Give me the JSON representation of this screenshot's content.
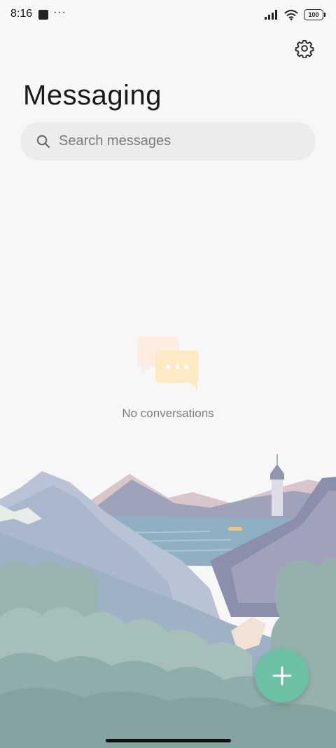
{
  "status_bar": {
    "time": "8:16",
    "overflow_dots": "···",
    "battery_level": "100"
  },
  "header": {
    "title": "Messaging",
    "settings_icon": "gear-icon"
  },
  "search": {
    "placeholder": "Search messages",
    "icon": "search-icon"
  },
  "empty_state": {
    "icon": "chat-bubbles-icon",
    "text": "No conversations"
  },
  "fab": {
    "icon": "plus-icon",
    "color": "#6cc0a3"
  },
  "colors": {
    "background": "#f7f7f7",
    "accent": "#6cc0a3",
    "search_background": "#ececec"
  }
}
